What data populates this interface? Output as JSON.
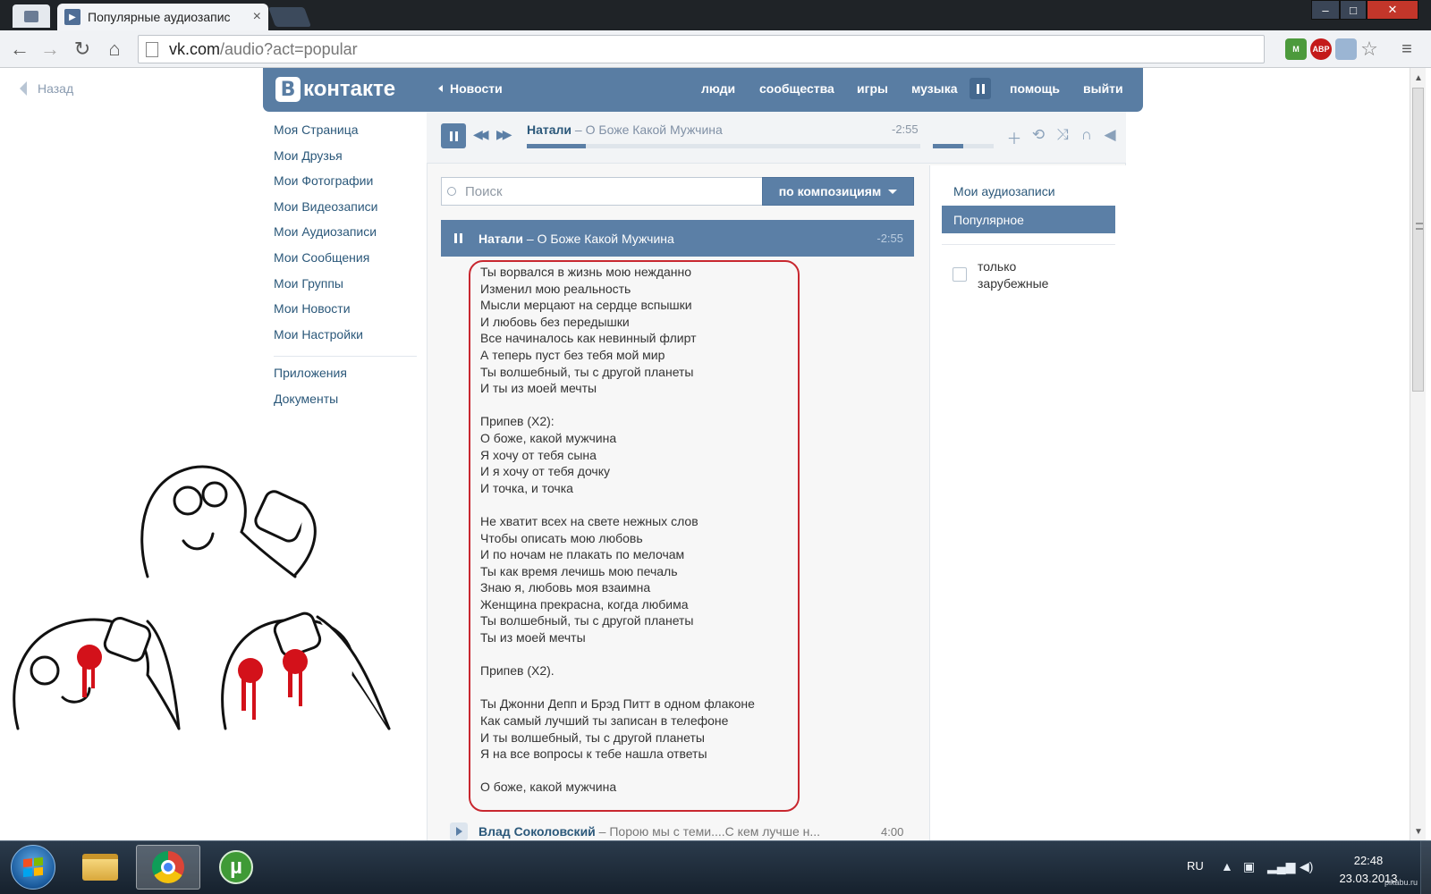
{
  "browser": {
    "tab_title": "Популярные аудиозапис",
    "tab_close": "×",
    "url_host": "vk.com",
    "url_path": "/audio?act=popular",
    "extensions": {
      "abp": "ABP",
      "m": "M"
    }
  },
  "page": {
    "back_label": "Назад"
  },
  "header": {
    "logo_letter": "В",
    "logo_word": "контакте",
    "news_label": "Новости",
    "nav": [
      "люди",
      "сообщества",
      "игры",
      "музыка",
      "помощь",
      "выйти"
    ]
  },
  "left_menu": {
    "items": [
      "Моя Страница",
      "Мои Друзья",
      "Мои Фотографии",
      "Мои Видеозаписи",
      "Мои Аудиозаписи",
      "Мои Сообщения",
      "Мои Группы",
      "Мои Новости",
      "Мои Настройки"
    ],
    "secondary": [
      "Приложения",
      "Документы"
    ]
  },
  "player": {
    "artist": "Натали",
    "sep": " – ",
    "song": "О Боже Какой Мужчина",
    "time": "-2:55",
    "progress": 0.15,
    "volume": 0.5,
    "icons": [
      "plus-icon",
      "repeat-icon",
      "shuffle-icon",
      "headphones-icon",
      "broadcast-icon"
    ]
  },
  "search": {
    "placeholder": "Поиск",
    "mode_label": "по композициям"
  },
  "tracks": {
    "active": {
      "artist": "Натали",
      "sep": " – ",
      "song": "О Боже Какой Мужчина",
      "duration": "-2:55"
    },
    "next": {
      "artist": "Влад Соколовский",
      "sep": " – ",
      "song": "Порою мы с теми....С кем лучше н...",
      "duration": "4:00"
    }
  },
  "lyrics": "Ты ворвался в жизнь мою нежданно\nИзменил мою реальность\nМысли мерцают на сердце вспышки\nИ любовь без передышки\nВсе начиналось как невинный флирт\nА теперь пуст без тебя мой мир\nТы волшебный, ты с другой планеты\nИ ты из моей мечты\n\nПрипев (Х2):\nО боже, какой мужчина\nЯ хочу от тебя сына\nИ я хочу от тебя дочку\nИ точка, и точка\n\nНе хватит всех на свете нежных слов\nЧтобы описать мою любовь\nИ по ночам не плакать по мелочам\nТы как время лечишь мою печаль\nЗнаю я, любовь моя взаимна\nЖенщина прекрасна, когда любима\nТы волшебный, ты с другой планеты\nТы из моей мечты\n\nПрипев (Х2).\n\nТы Джонни Депп и Брэд Питт в одном флаконе\nКак самый лучший ты записан в телефоне\nИ ты волшебный, ты с другой планеты\nЯ на все вопросы к тебе нашла ответы\n\nО боже, какой мужчина",
  "filters": {
    "my_audio": "Мои аудиозаписи",
    "popular": "Популярное",
    "foreign_only": "только зарубежные"
  },
  "taskbar": {
    "lang": "RU",
    "time": "22:48",
    "date": "23.03.2013",
    "utorrent_letter": "µ"
  },
  "watermark": "pikabu.ru",
  "colors": {
    "vk_blue": "#597da3",
    "lyrics_border": "#c8272f"
  }
}
